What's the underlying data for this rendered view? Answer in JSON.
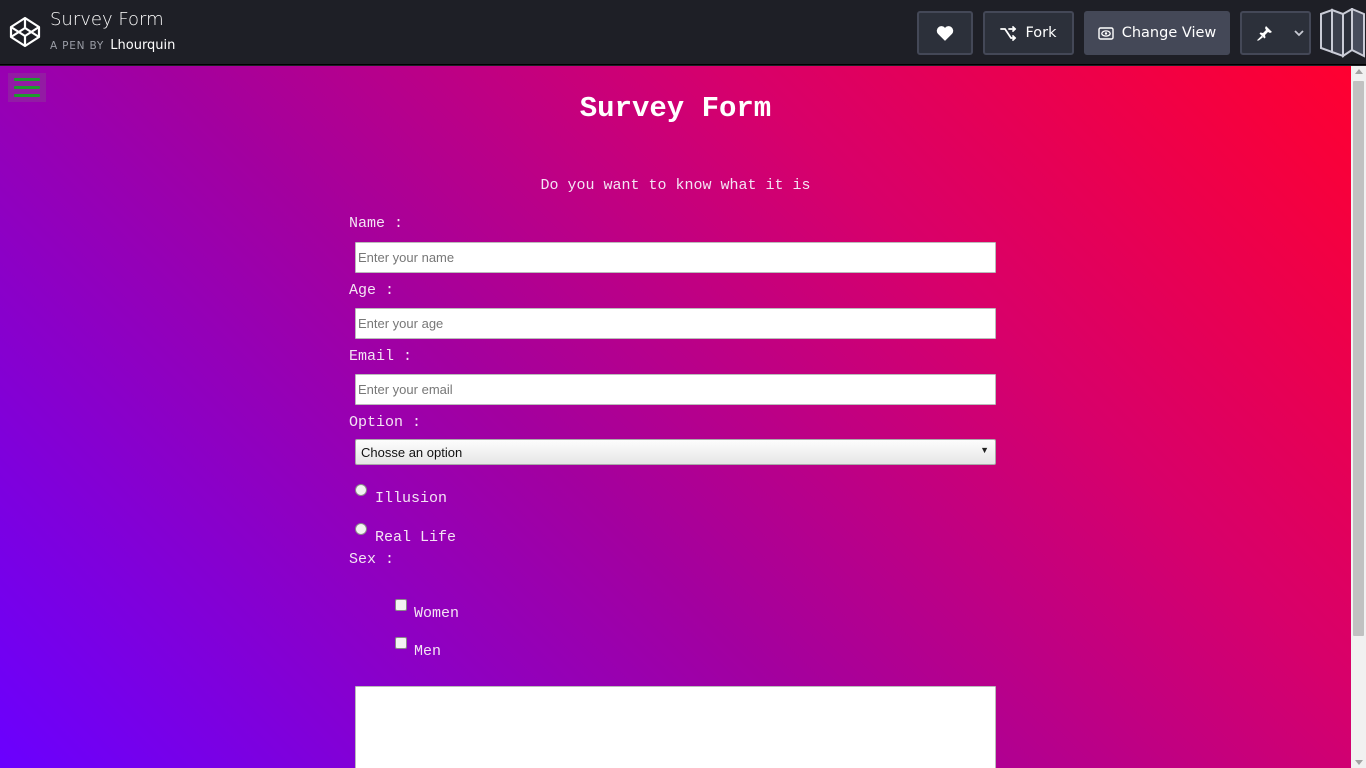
{
  "topbar": {
    "pen_title": "Survey Form",
    "byline_prefix": "A PEN BY",
    "author": "Lhourquin",
    "buttons": {
      "heart_icon": "heart-icon",
      "fork_label": "Fork",
      "change_view_label": "Change View",
      "pin_icon": "pin-icon"
    }
  },
  "preview": {
    "menu_icon": "hamburger-icon",
    "title": "Survey Form",
    "description": "Do you want to know what it is",
    "name": {
      "label": "Name :",
      "placeholder": "Enter your name"
    },
    "age": {
      "label": "Age :",
      "placeholder": "Enter your age"
    },
    "email": {
      "label": "Email :",
      "placeholder": "Enter your email"
    },
    "option": {
      "label": "Option :",
      "selected": "Chosse an option"
    },
    "radios": [
      "Illusion",
      "Real Life"
    ],
    "sex": {
      "label": "Sex :",
      "options": [
        "Women",
        "Men"
      ]
    }
  },
  "colors": {
    "topbar_bg": "#1e1f26",
    "gradient_start": "#6a00ff",
    "gradient_end": "#ff0030",
    "menu_bars": "#1e9a2e"
  }
}
